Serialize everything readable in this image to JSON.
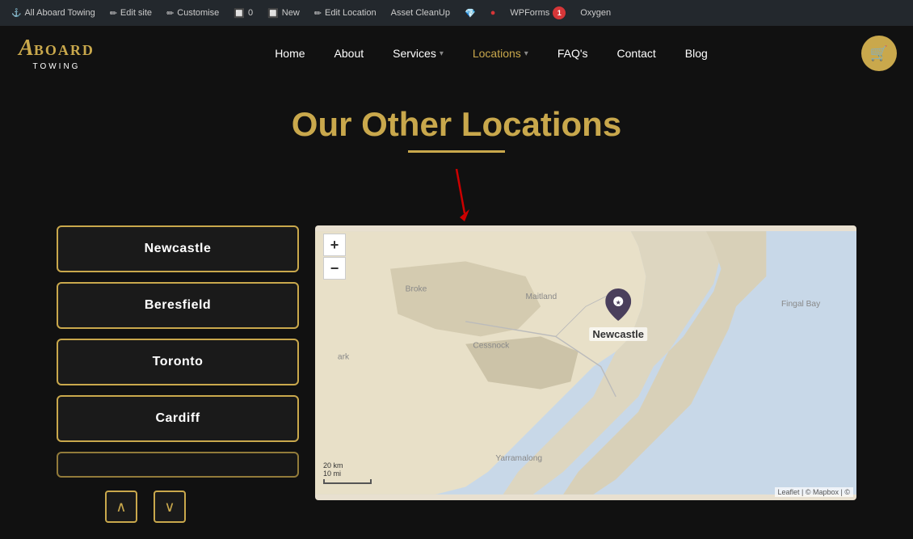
{
  "adminBar": {
    "items": [
      {
        "label": "All Aboard Towing",
        "icon": "⚓"
      },
      {
        "label": "Edit site",
        "icon": "✏"
      },
      {
        "label": "Customise",
        "icon": "✏"
      },
      {
        "label": "0",
        "icon": "🔲"
      },
      {
        "label": "New",
        "icon": "🔲"
      },
      {
        "label": "Edit Location",
        "icon": "✏"
      },
      {
        "label": "Asset CleanUp",
        "icon": ""
      },
      {
        "label": "",
        "icon": "💎"
      },
      {
        "label": "",
        "icon": "🔴"
      },
      {
        "label": "WPForms",
        "badge": "1",
        "icon": ""
      },
      {
        "label": "Oxygen",
        "icon": ""
      }
    ]
  },
  "nav": {
    "logoMain": "A BOARD",
    "logoSub": "TOWING",
    "items": [
      {
        "label": "Home",
        "active": false,
        "hasDropdown": false
      },
      {
        "label": "About",
        "active": false,
        "hasDropdown": false
      },
      {
        "label": "Services",
        "active": false,
        "hasDropdown": true
      },
      {
        "label": "Locations",
        "active": true,
        "hasDropdown": true
      },
      {
        "label": "FAQ's",
        "active": false,
        "hasDropdown": false
      },
      {
        "label": "Contact",
        "active": false,
        "hasDropdown": false
      },
      {
        "label": "Blog",
        "active": false,
        "hasDropdown": false
      }
    ]
  },
  "section": {
    "titlePart1": "Our Other ",
    "titlePart2": "Locations",
    "locations": [
      {
        "label": "Newcastle"
      },
      {
        "label": "Beresfield"
      },
      {
        "label": "Toronto"
      },
      {
        "label": "Cardiff"
      },
      {
        "label": "..."
      }
    ],
    "mapMarkerLabel": "Newcastle",
    "mapScaleKm": "20 km",
    "mapScaleMi": "10 mi",
    "mapAttribution": "Leaflet | © Mapbox | ©",
    "zoomIn": "+",
    "zoomOut": "−",
    "prevArrow": "∧",
    "nextArrow": "∨"
  }
}
